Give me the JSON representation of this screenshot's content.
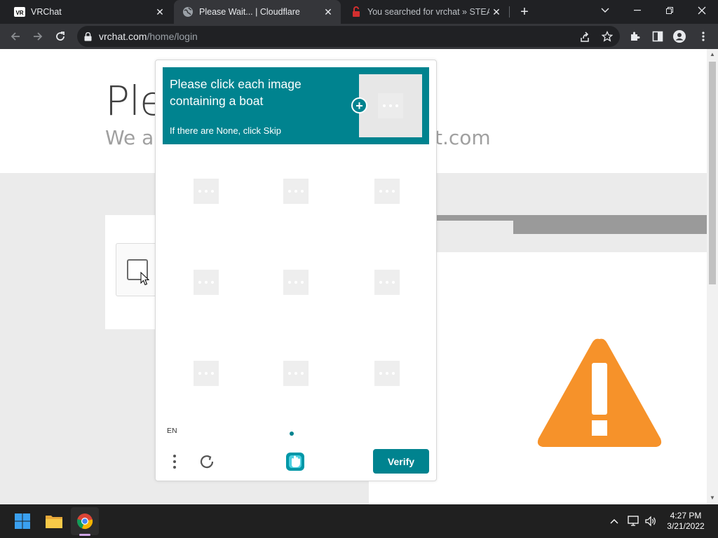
{
  "browser": {
    "tabs": [
      {
        "title": "VRChat",
        "favicon": "vrchat-logo-icon",
        "active": false
      },
      {
        "title": "Please Wait... | Cloudflare",
        "favicon": "globe-icon",
        "active": true
      },
      {
        "title": "You searched for vrchat » STEAM",
        "favicon": "steam-unlocked-icon",
        "active": false
      }
    ],
    "new_tab_label": "+",
    "url_host": "vrchat.com",
    "url_path": "/home/login"
  },
  "page": {
    "title_fragment": "Ple",
    "subtitle_left": "We ar",
    "subtitle_right": "t.com"
  },
  "captcha": {
    "prompt": "Please click each image containing a boat",
    "hint": "If there are None, click Skip",
    "language": "EN",
    "verify_label": "Verify",
    "accent_color": "#00838f",
    "grid_rows": 3,
    "grid_cols": 3
  },
  "taskbar": {
    "time": "4:27 PM",
    "date": "3/21/2022"
  },
  "colors": {
    "warning": "#f6922a"
  }
}
